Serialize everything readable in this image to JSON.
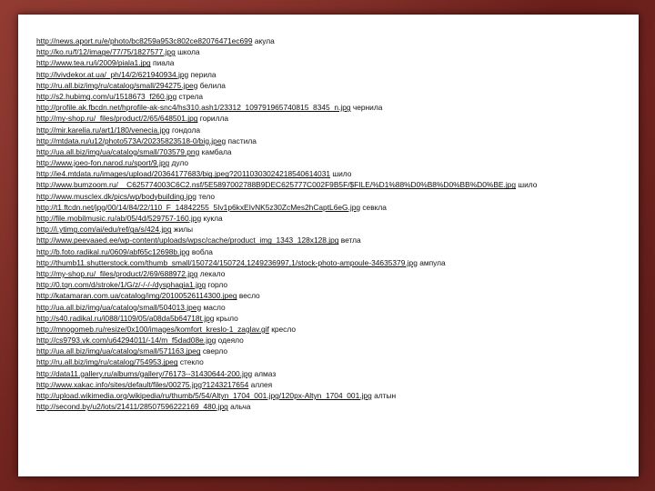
{
  "references": [
    {
      "url": "http://news.aport.ru/e/photo/bc8259a953c802ce82076471ec699",
      "label": "акула"
    },
    {
      "url": "http://ko.ru/f/12/image/77/75/1827577.jpg",
      "label": "школа"
    },
    {
      "url": "http://www.tea.ru/i/2009/piala1.jpg",
      "label": "пиала"
    },
    {
      "url": "http://lvivdekor.at.ua/_ph/14/2/621940934.jpg",
      "label": "перила"
    },
    {
      "url": "http://ru.all.biz/img/ru/catalog/small/294275.jpeg",
      "label": "белила"
    },
    {
      "url": "http://s2.hubimg.com/u/1518673_f260.jpg",
      "label": "стрела"
    },
    {
      "url": "http://profile.ak.fbcdn.net/hprofile-ak-snc4/hs310.ash1/23312_109791965740815_8345_n.jpg",
      "label": "чернила"
    },
    {
      "url": "http://my-shop.ru/_files/product/2/65/648501.jpg",
      "label": "горилла"
    },
    {
      "url": "http://mir.karelia.ru/art1/180/venecia.jpg",
      "label": "гондола"
    },
    {
      "url": "http://mtdata.ru/u12/photo573A/20235823518-0/big.jpeg",
      "label": "пастила"
    },
    {
      "url": "http://ua.all.biz/img/ua/catalog/small/703579.png",
      "label": "камбала"
    },
    {
      "url": "http://www.joeo-fon.narod.ru/sport/9.jpg",
      "label": "дуло"
    },
    {
      "url": "http://ie4.mtdata.ru/images/upload/20364177683/big.jpeg?20110303024218540614031",
      "label": "шило"
    },
    {
      "url": "http://www.bumzoom.ru/__C625774003C6C2.nsf/5E5897002788B9DEC625777C002F9B5F/$FILE/%D1%88%D0%B8%D0%BB%D0%BE.jpg",
      "label": "шило",
      "wrap": true
    },
    {
      "url": "http://www.musclex.dk/pics/wp/bodybuilding.jpg",
      "label": "тело"
    },
    {
      "url": "http://t1.ftcdn.net/jpg/00/14/84/22/110_F_14842255_5Iv1p6kxEIvNK5z30ZcMes2hCaptL6eG.jpg",
      "label": "севкла"
    },
    {
      "url": "http://file.mobilmusic.ru/ab/05/4d/529757-160.jpg",
      "label": "кукла"
    },
    {
      "url": "http://i.ytimg.com/ai/edu/ref/ga/s/424.jpg",
      "label": "жилы"
    },
    {
      "url": "http://www.peevaaed.ee/wp-content/uploads/wpsc/cache/product_img_1343_128x128.jpg",
      "label": "ветла"
    },
    {
      "url": "http://b.foto.radikal.ru/0609/abf65c12698b.jpg",
      "label": "вобла"
    },
    {
      "url": "http://thumb11.shutterstock.com/thumb_small/150724/150724,1249236997,1/stock-photo-ampoule-34635379.jpg",
      "label": "ампула"
    },
    {
      "url": "http://my-shop.ru/_files/product/2/69/688972.jpg",
      "label": "лекало"
    },
    {
      "url": "http://0.tqn.com/d/stroke/1/G/z/-/-/-/dysphagia1.jpg",
      "label": "горло"
    },
    {
      "url": "http://katamaran.com.ua/catalog/img/20100526114300.jpeg",
      "label": "весло"
    },
    {
      "url": "http://ua.all.biz/img/ua/catalog/small/504013.jpeg",
      "label": "масло"
    },
    {
      "url": "http://s40.radikal.ru/i088/1109/05/a08da5b64718t.jpg",
      "label": "крыло"
    },
    {
      "url": "http://mnogomeb.ru/resize/0x100/images/komfort_kreslo-1_zaglav.gif",
      "label": "кресло"
    },
    {
      "url": "http://cs9793.vk.com/u64294011/-14/m_f5dad08e.jpg",
      "label": "одеяло"
    },
    {
      "url": "http://ua.all.biz/img/ua/catalog/small/571163.jpeg",
      "label": "сверло"
    },
    {
      "url": "http://ru.all.biz/img/ru/catalog/754953.jpeg",
      "label": "стекло"
    },
    {
      "url": "http://data11.gallery.ru/albums/gallery/76173--31430644-200.jpg",
      "label": "алмаз"
    },
    {
      "url": "http://www.xakac.info/sites/default/files/00275.jpg?1243217654",
      "label": "аллея"
    },
    {
      "url": "http://upload.wikimedia.org/wikipedia/ru/thumb/5/54/Altyn_1704_001.jpg/120px-Altyn_1704_001.jpg",
      "label": "алтын"
    },
    {
      "url": "http://second.by/u2/lots/21411/28507596222169_480.jpg",
      "label": "альча"
    }
  ]
}
